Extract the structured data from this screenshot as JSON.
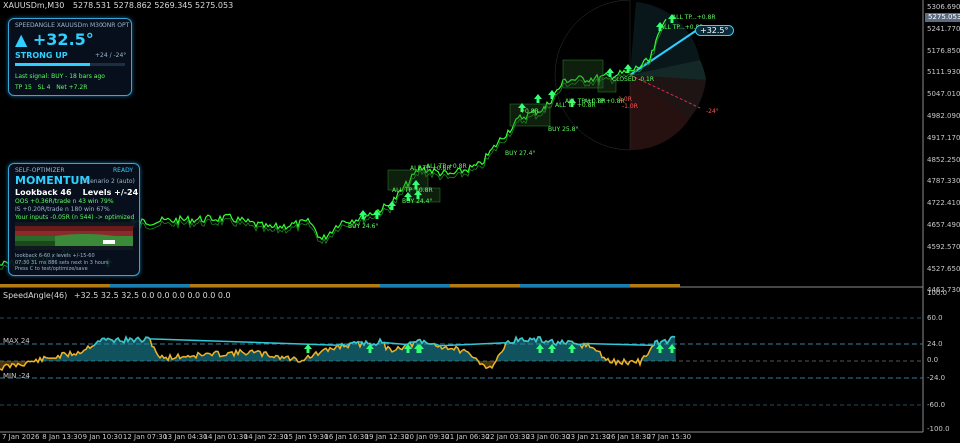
{
  "main_chart": {
    "symbol_header": "XAUUSDm,M30",
    "ohlc": [
      "5278.531",
      "5278.862",
      "5269.345",
      "5275.053"
    ],
    "price_ticks": [
      "5306.690",
      "5241.770",
      "5176.850",
      "5111.930",
      "5047.010",
      "4982.090",
      "4917.170",
      "4852.250",
      "4787.330",
      "4722.410",
      "4657.490",
      "4592.570",
      "4527.650",
      "4462.730"
    ],
    "current_price_tag": "5275.053",
    "colors": {
      "background": "#000000",
      "price_line": "#33ff33",
      "grid": "#1a1a1a",
      "accent": "#3ab8e8",
      "sell": "#ff3333"
    },
    "annotations": [
      {
        "text": "ALL TP +0.8R"
      },
      {
        "text": "ALL TP +0.8R"
      },
      {
        "text": "ALL TP +0.8R"
      },
      {
        "text": "BUY 24.6°"
      },
      {
        "text": "BUY 24.4°"
      },
      {
        "text": "BUY 27.4°"
      },
      {
        "text": "BUY 25.8°"
      },
      {
        "text": "ALL TP +0.8R"
      },
      {
        "text": "+0.8R"
      },
      {
        "text": "ALL TP +0.8R"
      },
      {
        "text": "ALL TP +0.8R"
      },
      {
        "text": "-1.0R"
      },
      {
        "text": "-1.0R"
      },
      {
        "text": "ALL TP...+0.8R"
      },
      {
        "text": "ALL TP...+0.8R"
      },
      {
        "text": "CLOSED -0.1R"
      },
      {
        "text": "-24°"
      }
    ],
    "speed_badge": "+32.5°"
  },
  "speed_panel": {
    "title": "SPEEDANGLE XAUUSDm M30",
    "mode": "ONR OPT",
    "angle_value": "+32.5°",
    "arrow": "▲",
    "direction": "STRONG UP",
    "range": "+24 / -24°",
    "last_signal": "Last signal: BUY  -  18 bars ago",
    "tp": "TP 15",
    "sl": "SL 4",
    "net": "Net +7.2R",
    "gauge_fraction": 0.68
  },
  "optimizer_panel": {
    "title": "SELF-OPTIMIZER",
    "status": "READY",
    "strategy": "MOMENTUM",
    "scenario": "Scenario 2 (auto)",
    "lookback": "Lookback 46",
    "levels": "Levels +/-24",
    "oos_line": "OOS  +0.36R/trade   n 43   win 79%",
    "is_line": "IS   +0.20R/trade   n 180   win 67%",
    "inputs_line": "Your inputs -0.05R (n 544)  ->  optimized",
    "bottom_line1": "lookback 6-60  x  levels +/-15-60",
    "bottom_line2": "07:30  31 ms   886 sets   next in 3 hours",
    "bottom_line3": "Press C to test/optimize/save"
  },
  "indicator": {
    "header": "SpeedAngle(46)",
    "values": "+32.5 32.5 32.5 0.0 0.0 0.0 0.0 0.0 0.0",
    "ticks": [
      "100.0",
      "60.0",
      "24.0",
      "0.0",
      "-24.0",
      "-60.0",
      "-100.0"
    ],
    "max_label": "MAX 24",
    "min_label": "MIN -24",
    "colors": {
      "up": "#2ec8d8",
      "down": "#f0b429",
      "zero": "#ffffff"
    }
  },
  "time_axis": [
    "7 Jan 2026",
    "8 Jan 13:30",
    "9 Jan 10:30",
    "12 Jan 07:30",
    "13 Jan 04:30",
    "14 Jan 01:30",
    "14 Jan 22:30",
    "15 Jan 19:30",
    "16 Jan 16:30",
    "19 Jan 12:30",
    "20 Jan 09:30",
    "21 Jan 06:30",
    "22 Jan 03:30",
    "23 Jan 00:30",
    "23 Jan 21:30",
    "26 Jan 18:30",
    "27 Jan 15:30"
  ]
}
